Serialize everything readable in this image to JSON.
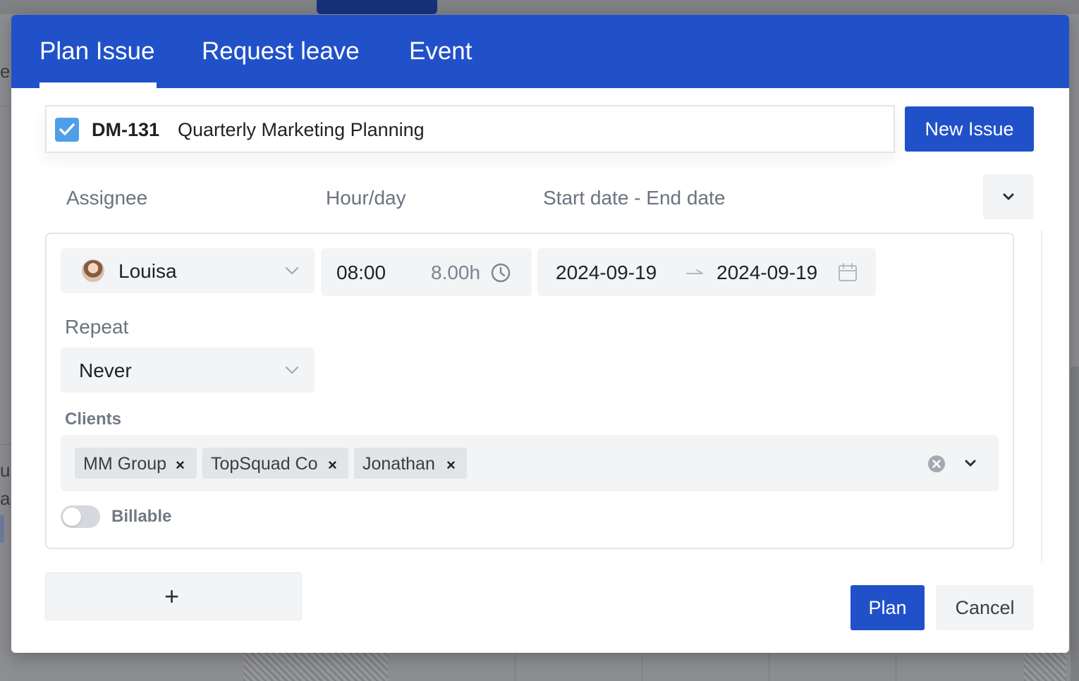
{
  "background": {
    "left_fragments": [
      "el",
      "ui",
      "al"
    ]
  },
  "tabs": [
    {
      "label": "Plan Issue",
      "active": true
    },
    {
      "label": "Request leave",
      "active": false
    },
    {
      "label": "Event",
      "active": false
    }
  ],
  "issue": {
    "checked": true,
    "key": "DM-131",
    "title": "Quarterly Marketing Planning"
  },
  "new_issue_label": "New Issue",
  "columns": {
    "assignee": "Assignee",
    "hours": "Hour/day",
    "dates": "Start date - End date"
  },
  "plan": {
    "assignee": "Louisa",
    "time": "08:00",
    "hours": "8.00h",
    "start_date": "2024-09-19",
    "end_date": "2024-09-19",
    "repeat_label": "Repeat",
    "repeat_value": "Never",
    "clients_label": "Clients",
    "clients": [
      "MM Group",
      "TopSquad Co",
      "Jonathan"
    ],
    "tag_remove": "×",
    "billable_label": "Billable",
    "billable": false
  },
  "add_row_symbol": "+",
  "footer": {
    "plan_label": "Plan",
    "cancel_label": "Cancel"
  },
  "colors": {
    "primary": "#2151c9",
    "checkbox": "#4f9ee8",
    "muted_text": "#6b7280",
    "field_bg": "#f3f4f6"
  }
}
